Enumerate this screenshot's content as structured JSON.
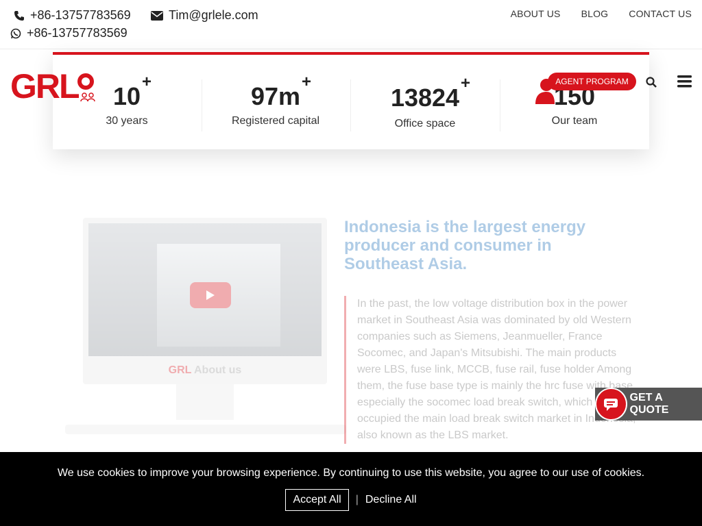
{
  "topbar": {
    "phone": "+86-13757783569",
    "email": "Tim@grlele.com",
    "whatsapp": "+86-13757783569",
    "links": [
      "ABOUT US",
      "BLOG",
      "CONTACT US"
    ]
  },
  "header": {
    "logo": "GRL",
    "agent_button": "AGENT PROGRAM"
  },
  "stats": [
    {
      "value": "10",
      "suffix": "+",
      "label": "30 years"
    },
    {
      "value": "97m",
      "suffix": "+",
      "label": "Registered capital"
    },
    {
      "value": "13824",
      "suffix": "+",
      "label": "Office space"
    },
    {
      "value": "150",
      "suffix": "",
      "label": "Our team"
    }
  ],
  "video": {
    "brand": "GRL",
    "caption": "About us"
  },
  "article": {
    "headline": "Indonesia is the largest energy producer and consumer in Southeast Asia.",
    "body": "In the past, the low voltage distribution box in the power market in Southeast Asia was dominated by old Western companies such as Siemens, Jeanmueller, France Socomec, and Japan's Mitsubishi. The main products were LBS, fuse link, MCCB, fuse rail, fuse holder Among them, the fuse base type is mainly the hrc fuse with base especially the socomec load break switch, which occupied the main load break switch market in Indonesia, also known as the LBS market."
  },
  "quote_button": "GET A QUOTE",
  "cookie": {
    "message": "We use cookies to improve your browsing experience. By continuing to use this website, you agree to our use of cookies.",
    "accept": "Accept All",
    "separator": "|",
    "decline": "Decline All"
  },
  "colors": {
    "brand_red": "#d7141d",
    "headline_blue": "#1e6fb8"
  }
}
